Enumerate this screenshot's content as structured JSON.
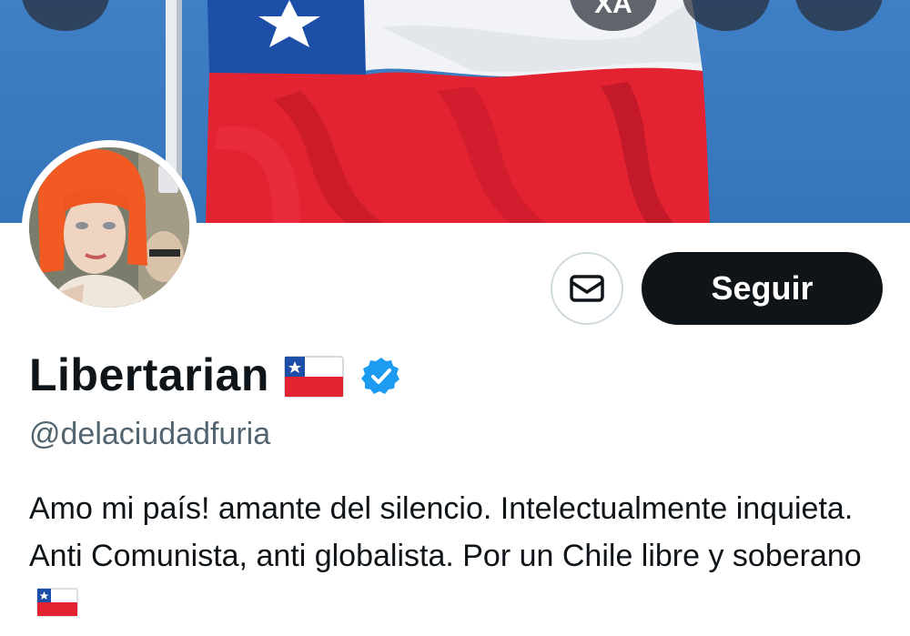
{
  "header": {
    "buttons": [
      {
        "name": "back-button",
        "icon": "arrow-left-icon"
      },
      {
        "name": "translate-button",
        "label": "XA"
      },
      {
        "name": "search-button",
        "icon": "search-icon"
      },
      {
        "name": "more-button",
        "icon": "more-vertical-icon"
      }
    ]
  },
  "actions": {
    "message_icon": "mail-icon",
    "follow_label": "Seguir"
  },
  "profile": {
    "display_name": "Libertarian",
    "name_flag": "chile-flag",
    "verified": true,
    "handle": "@delaciudadfuria",
    "bio_text": "Amo mi país! amante del silencio. Intelectualmente inquieta. Anti Comunista, anti globalista. Por un Chile libre y soberano",
    "bio_flag": "chile-flag"
  },
  "colors": {
    "primary_text": "#0f1419",
    "secondary_text": "#536471",
    "follow_button_bg": "#0f1419",
    "verified_badge": "#1d9bf0",
    "flag_red": "#e42332",
    "flag_blue": "#1d4fa8"
  }
}
